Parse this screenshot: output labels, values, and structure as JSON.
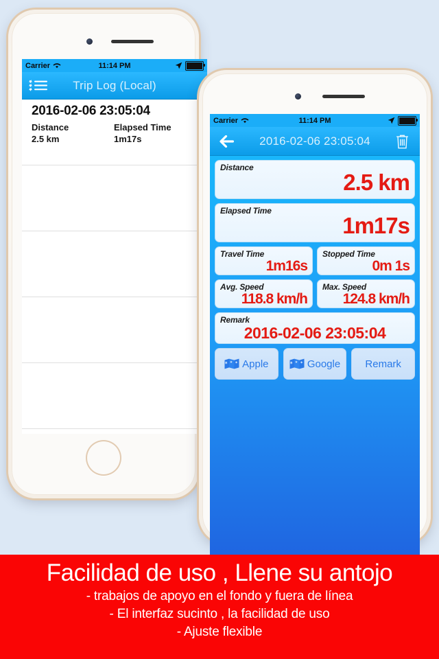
{
  "background_color": "#dce8f5",
  "accent_blue": "#1badf8",
  "value_red": "#e41b13",
  "banner_red": "#fa0505",
  "back_phone": {
    "status_bar": {
      "carrier": "Carrier",
      "wifi_icon": "wifi-icon",
      "time": "11:14 PM",
      "location_icon": "location-arrow-icon",
      "battery_icon": "battery-icon"
    },
    "navbar": {
      "menu_icon": "list-bullets-icon",
      "title": "Trip Log (Local)"
    },
    "list": {
      "rows": [
        {
          "title": "2016-02-06 23:05:04",
          "columns": [
            {
              "header": "Distance",
              "value": "2.5 km"
            },
            {
              "header": "Elapsed Time",
              "value": "1m17s"
            }
          ]
        }
      ],
      "empty_row_count": 5
    }
  },
  "front_phone": {
    "status_bar": {
      "carrier": "Carrier",
      "wifi_icon": "wifi-icon",
      "time": "11:14 PM",
      "location_icon": "location-arrow-icon",
      "battery_icon": "battery-icon"
    },
    "navbar": {
      "back_icon": "back-arrow-icon",
      "title": "2016-02-06 23:05:04",
      "delete_icon": "trash-icon"
    },
    "cards": {
      "distance": {
        "label": "Distance",
        "value": "2.5 km"
      },
      "elapsed_time": {
        "label": "Elapsed Time",
        "value": "1m17s"
      },
      "travel_time": {
        "label": "Travel Time",
        "value": "1m16s"
      },
      "stopped_time": {
        "label": "Stopped Time",
        "value": "0m 1s"
      },
      "avg_speed": {
        "label": "Avg. Speed",
        "value": "118.8 km/h"
      },
      "max_speed": {
        "label": "Max. Speed",
        "value": "124.8 km/h"
      },
      "remark": {
        "label": "Remark",
        "value": "2016-02-06 23:05:04"
      }
    },
    "buttons": [
      {
        "label": "Apple",
        "icon": "map-icon"
      },
      {
        "label": "Google",
        "icon": "map-icon"
      },
      {
        "label": "Remark",
        "icon": null
      }
    ]
  },
  "banner": {
    "headline": "Facilidad de uso , Llene su antojo",
    "lines": [
      "- trabajos de apoyo en el fondo y fuera de línea",
      "- El interfaz sucinto , la facilidad de uso",
      "- Ajuste flexible"
    ]
  }
}
